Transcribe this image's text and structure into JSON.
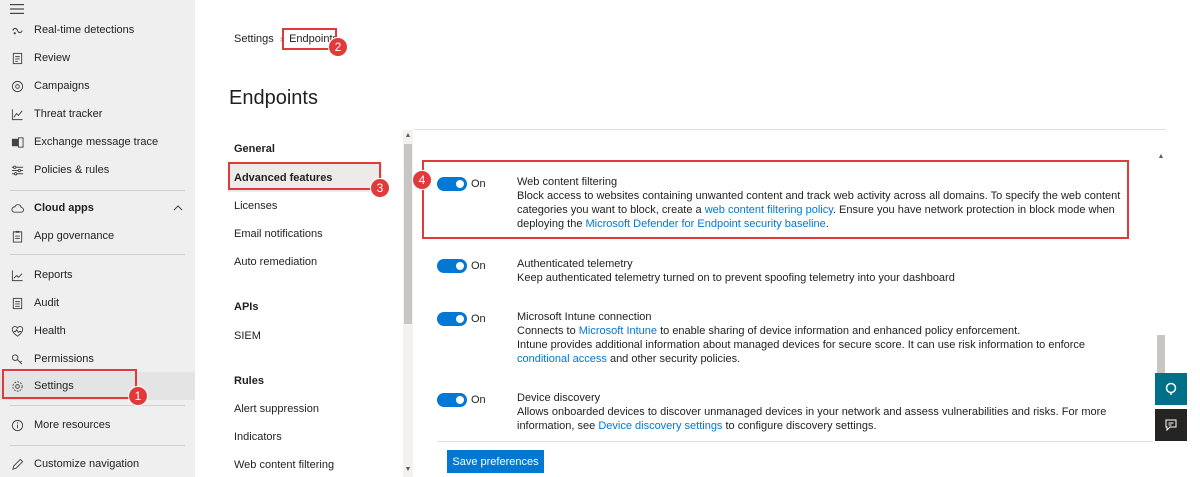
{
  "nav": {
    "items": [
      {
        "label": "Real-time detections",
        "icon": "detections-icon"
      },
      {
        "label": "Review",
        "icon": "review-icon"
      },
      {
        "label": "Campaigns",
        "icon": "campaigns-icon"
      },
      {
        "label": "Threat tracker",
        "icon": "chart-icon"
      },
      {
        "label": "Exchange message trace",
        "icon": "exchange-icon"
      },
      {
        "label": "Policies & rules",
        "icon": "sliders-icon"
      },
      {
        "label": "Cloud apps",
        "icon": "cloud-icon"
      },
      {
        "label": "App governance",
        "icon": "clipboard-icon"
      },
      {
        "label": "Reports",
        "icon": "reports-icon"
      },
      {
        "label": "Audit",
        "icon": "audit-icon"
      },
      {
        "label": "Health",
        "icon": "heart-icon"
      },
      {
        "label": "Permissions",
        "icon": "key-icon"
      },
      {
        "label": "Settings",
        "icon": "gear-icon"
      },
      {
        "label": "More resources",
        "icon": "info-icon"
      },
      {
        "label": "Customize navigation",
        "icon": "pencil-icon"
      }
    ]
  },
  "breadcrumb": {
    "root": "Settings",
    "current": "Endpoints"
  },
  "page": {
    "title": "Endpoints"
  },
  "inner_nav": {
    "general": "General",
    "advanced": "Advanced features",
    "licenses": "Licenses",
    "email": "Email notifications",
    "auto": "Auto remediation",
    "apis": "APIs",
    "siem": "SIEM",
    "rules": "Rules",
    "alert_suppression": "Alert suppression",
    "indicators": "Indicators",
    "wcf": "Web content filtering"
  },
  "settings": {
    "wcf": {
      "state": "On",
      "title": "Web content filtering",
      "d1": "Block access to websites containing unwanted content and track web activity across all domains. To specify the web content categories you want to block, create a ",
      "l1": "web content filtering policy",
      "d2": ". Ensure you have network protection in block mode when deploying the ",
      "l2": "Microsoft Defender for Endpoint security baseline",
      "d3": "."
    },
    "telemetry": {
      "state": "On",
      "title": "Authenticated telemetry",
      "d1": "Keep authenticated telemetry turned on to prevent spoofing telemetry into your dashboard"
    },
    "intune": {
      "state": "On",
      "title": "Microsoft Intune connection",
      "d1": "Connects to ",
      "l1": "Microsoft Intune",
      "d2": " to enable sharing of device information and enhanced policy enforcement.",
      "d3": "Intune provides additional information about managed devices for secure score. It can use risk information to enforce ",
      "l2": "conditional access",
      "d4": " and other security policies."
    },
    "discovery": {
      "state": "On",
      "title": "Device discovery",
      "d1": "Allows onboarded devices to discover unmanaged devices in your network and assess vulnerabilities and risks. For more information, see ",
      "l1": "Device discovery settings",
      "d2": " to configure discovery settings."
    }
  },
  "save_label": "Save preferences",
  "badges": {
    "b1": "1",
    "b2": "2",
    "b3": "3",
    "b4": "4"
  },
  "colors": {
    "accent": "#0078d4",
    "annotation": "#e03a3a"
  }
}
